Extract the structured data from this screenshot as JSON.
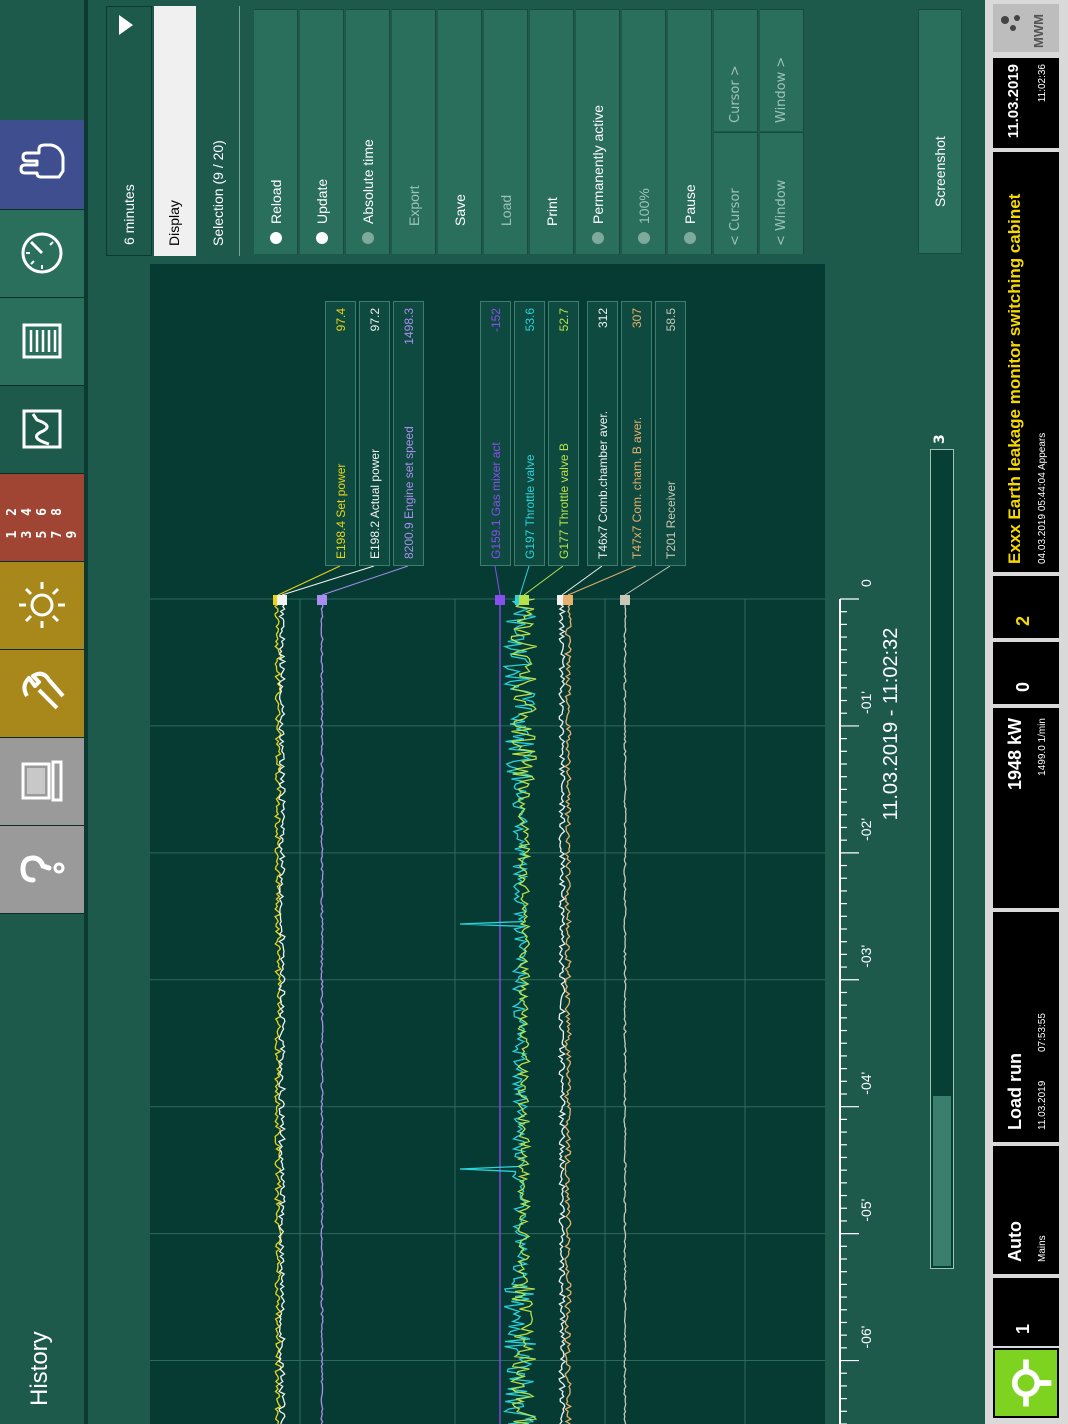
{
  "header": {
    "title": "History",
    "tabs": [
      {
        "name": "help",
        "color": "#9a9a9a"
      },
      {
        "name": "terminal",
        "color": "#9a9a9a"
      },
      {
        "name": "tools",
        "color": "#a8881a"
      },
      {
        "name": "sun",
        "color": "#a8881a"
      },
      {
        "name": "numbers",
        "color": "#a04434",
        "label": "1 2 3 4 5 6 7 8 9"
      },
      {
        "name": "history-chart",
        "color": "#1e6a58"
      },
      {
        "name": "list",
        "color": "#2a6e5c"
      },
      {
        "name": "gauge",
        "color": "#2a6e5c"
      },
      {
        "name": "hand",
        "color": "#3e4e8e"
      }
    ]
  },
  "colors": {
    "background": "#1e5a4c",
    "plot": "#053b33",
    "yellow": "#e9d418",
    "white": "#f2f2f2",
    "lavender": "#a98ef0",
    "purple": "#8a4df0",
    "cyan": "#2bd3dc",
    "lime": "#b8e24a",
    "orange": "#e7b06c",
    "grey": "#c8c8b8",
    "accent": "#7ed321"
  },
  "chart_data": {
    "type": "line",
    "x_tick_labels": [
      "-06'",
      "-05'",
      "-04'",
      "-03'",
      "-02'",
      "-01'",
      "0"
    ],
    "x_range": [
      -6.5,
      0
    ],
    "time_range": "11.03.2019 - 11:02:32",
    "scrollbar_value": "3",
    "series": [
      {
        "name": "E198.4 Set power",
        "value": "97.4",
        "color": "#e9d418"
      },
      {
        "name": "E198.2 Actual power",
        "value": "97.2",
        "color": "#f2f2f2"
      },
      {
        "name": "8200.9 Engine set speed",
        "value": "1498.3",
        "color": "#a98ef0"
      },
      {
        "name": "G159.1 Gas mixer act",
        "value": "-152",
        "color": "#8a4df0"
      },
      {
        "name": "G197 Throttle valve",
        "value": "53.6",
        "color": "#2bd3dc"
      },
      {
        "name": "G177 Throttle valve B",
        "value": "52.7",
        "color": "#b8e24a"
      },
      {
        "name": "T46x7 Comb.chamber aver.",
        "value": "312",
        "color": "#f2f2f2"
      },
      {
        "name": "T47x7 Com. cham. B aver.",
        "value": "307",
        "color": "#e7b06c"
      },
      {
        "name": "T201 Receiver",
        "value": "58.5",
        "color": "#c8c8b8"
      }
    ]
  },
  "right_panel": {
    "duration": "6 minutes",
    "display": "Display",
    "selection": "Selection (9 / 20)",
    "reload": "Reload",
    "update": "Update",
    "absolute_time": "Absolute time",
    "export": "Export",
    "save": "Save",
    "load": "Load",
    "print": "Print",
    "permanently_active": "Permanently active",
    "zoom": "100%",
    "pause": "Pause",
    "cursor_prev": "< Cursor",
    "cursor_next": "Cursor >",
    "window_prev": "< Window",
    "window_next": "Window >",
    "screenshot": "Screenshot"
  },
  "status_bar": {
    "unit": "1",
    "mode": "Auto",
    "mode_sub": "Mains",
    "state": "Load run",
    "state_date": "11.03.2019",
    "state_time": "07:53:55",
    "power": "1948 kW",
    "speed": "1499.0 1/min",
    "count_a": "0",
    "count_b": "2",
    "alarm": "Exxx Earth leakage monitor switching cabinet",
    "alarm_sub": "04.03.2019 05:44:04 Appears",
    "date": "11.03.2019",
    "time": "11:02:36",
    "logo": "MWM"
  }
}
